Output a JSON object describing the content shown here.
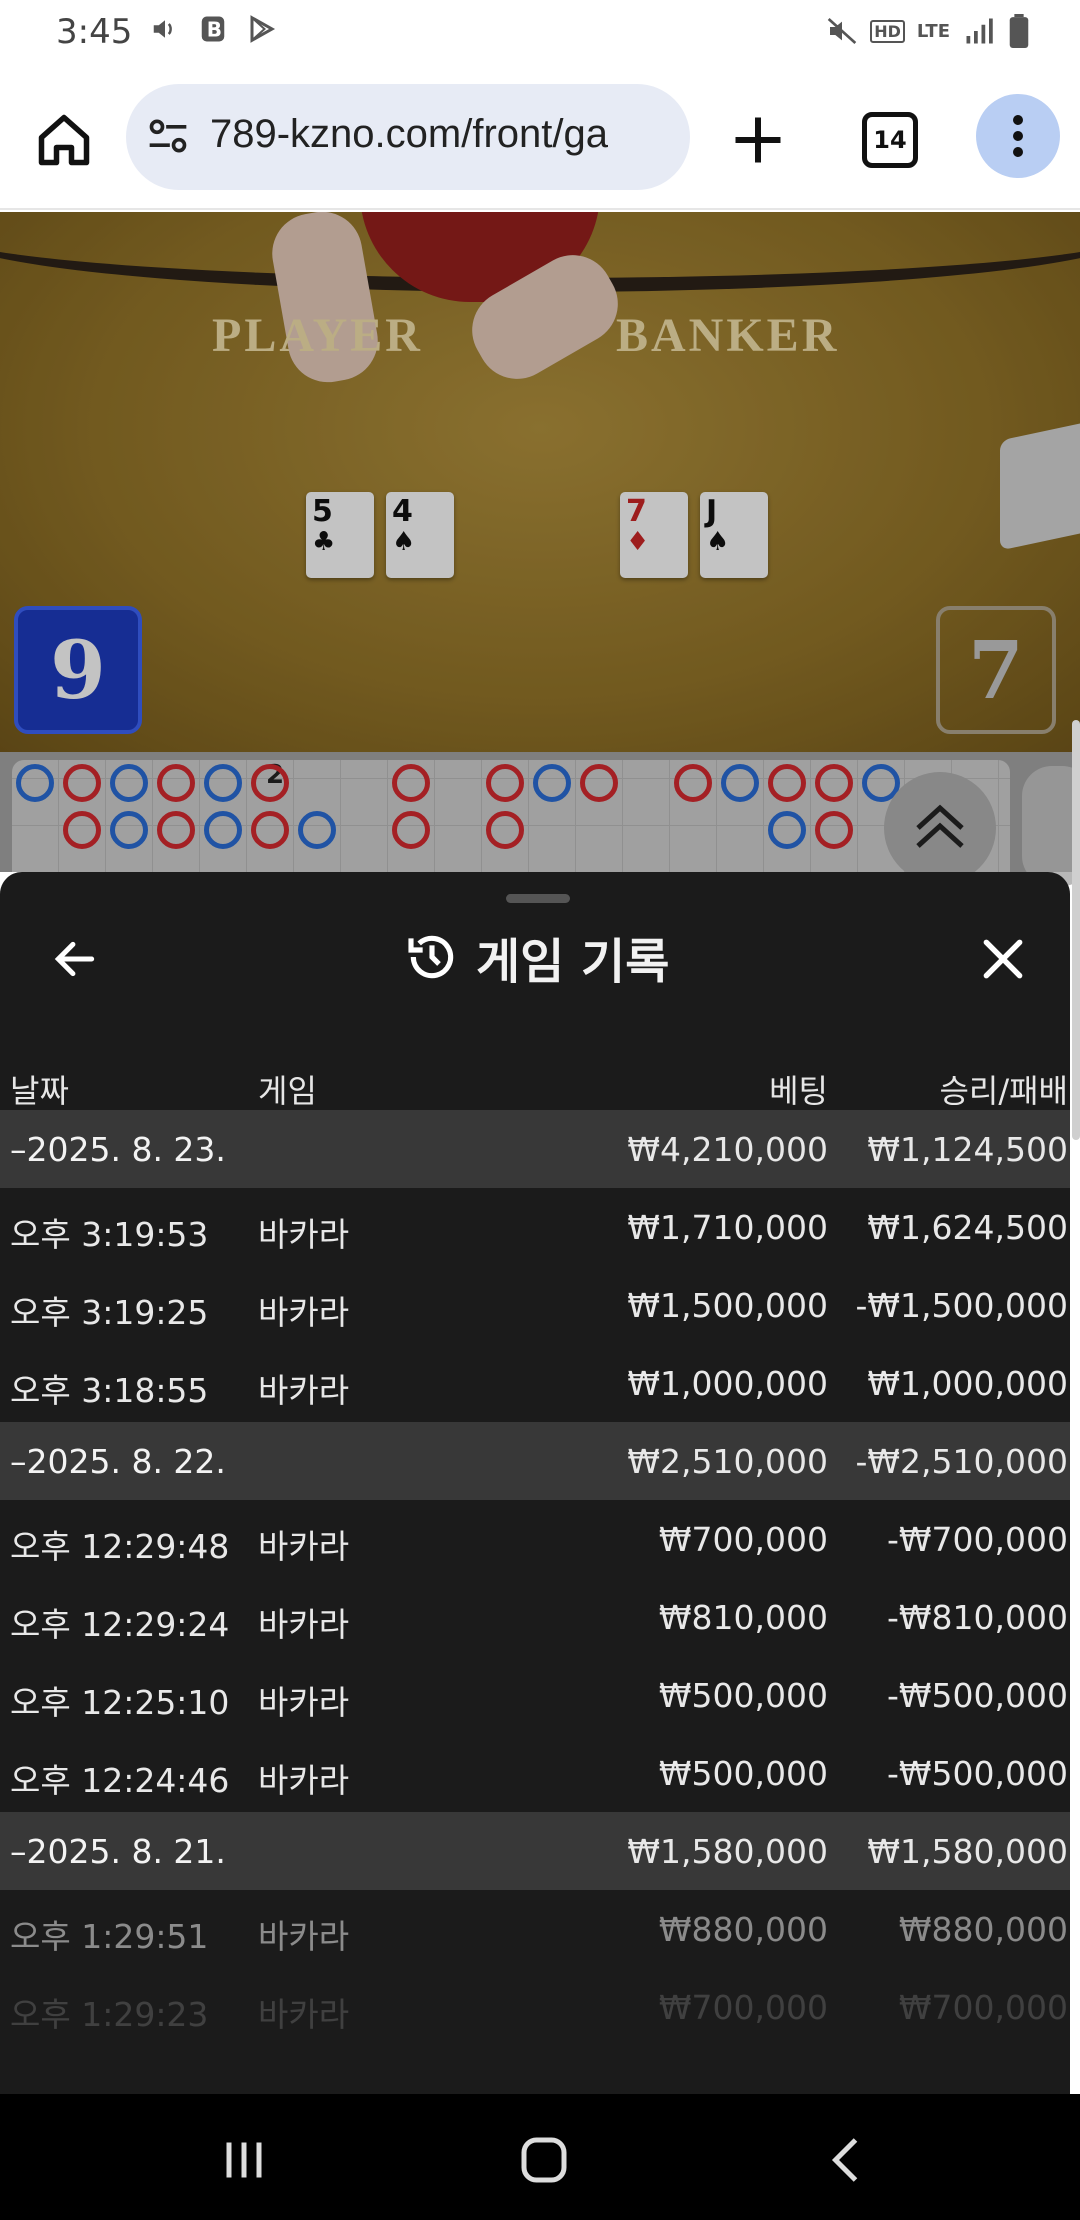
{
  "status_bar": {
    "time": "3:45",
    "network": "LTE",
    "voice": "HD"
  },
  "browser": {
    "url": "789-kzno.com/front/ga",
    "tab_count": "14"
  },
  "game": {
    "player_label": "PLAYER",
    "banker_label": "BANKER",
    "player_cards": [
      {
        "rank": "5",
        "suit": "♣",
        "color": "black"
      },
      {
        "rank": "4",
        "suit": "♠",
        "color": "black"
      }
    ],
    "banker_cards": [
      {
        "rank": "7",
        "suit": "♦",
        "color": "red"
      },
      {
        "rank": "J",
        "suit": "♠",
        "color": "black"
      }
    ],
    "player_score": "9",
    "banker_score": "7",
    "roadmap_marker": "2"
  },
  "sheet": {
    "title": "게임 기록",
    "columns": {
      "date": "날짜",
      "game": "게임",
      "bet": "베팅",
      "result": "승리/패배"
    },
    "rows": [
      {
        "type": "group",
        "date": "–2025. 8. 23.",
        "game": "",
        "bet": "₩4,210,000",
        "result": "₩1,124,500"
      },
      {
        "type": "item",
        "date": "오후 3:19:53",
        "game": "바카라",
        "bet": "₩1,710,000",
        "result": "₩1,624,500"
      },
      {
        "type": "item",
        "date": "오후 3:19:25",
        "game": "바카라",
        "bet": "₩1,500,000",
        "result": "-₩1,500,000"
      },
      {
        "type": "item",
        "date": "오후 3:18:55",
        "game": "바카라",
        "bet": "₩1,000,000",
        "result": "₩1,000,000"
      },
      {
        "type": "group",
        "date": "–2025. 8. 22.",
        "game": "",
        "bet": "₩2,510,000",
        "result": "-₩2,510,000"
      },
      {
        "type": "item",
        "date": "오후 12:29:48",
        "game": "바카라",
        "bet": "₩700,000",
        "result": "-₩700,000"
      },
      {
        "type": "item",
        "date": "오후 12:29:24",
        "game": "바카라",
        "bet": "₩810,000",
        "result": "-₩810,000"
      },
      {
        "type": "item",
        "date": "오후 12:25:10",
        "game": "바카라",
        "bet": "₩500,000",
        "result": "-₩500,000"
      },
      {
        "type": "item",
        "date": "오후 12:24:46",
        "game": "바카라",
        "bet": "₩500,000",
        "result": "-₩500,000"
      },
      {
        "type": "group",
        "date": "–2025. 8. 21.",
        "game": "",
        "bet": "₩1,580,000",
        "result": "₩1,580,000"
      },
      {
        "type": "item",
        "date": "오후 1:29:51",
        "game": "바카라",
        "bet": "₩880,000",
        "result": "₩880,000"
      },
      {
        "type": "item",
        "date": "오후 1:29:23",
        "game": "바카라",
        "bet": "₩700,000",
        "result": "₩700,000"
      }
    ]
  },
  "colors": {
    "sheet_bg": "#1b1b1b",
    "group_row_bg": "#383838",
    "player_blue": "#1b37b4",
    "banker_red": "#c8282d"
  }
}
